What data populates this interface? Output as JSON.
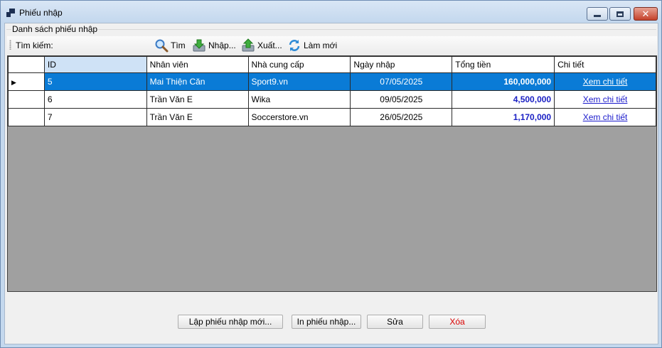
{
  "window": {
    "title": "Phiếu nhập"
  },
  "group": {
    "label": "Danh sách phiếu nhập"
  },
  "toolbar": {
    "search_label": "Tìm kiếm:",
    "find_label": "Tìm",
    "import_label": "Nhập...",
    "export_label": "Xuất...",
    "refresh_label": "Làm mới"
  },
  "grid": {
    "columns": [
      "ID",
      "Nhân viên",
      "Nhà cung cấp",
      "Ngày nhập",
      "Tổng tiền",
      "Chi tiết"
    ],
    "rows": [
      {
        "id": "5",
        "employee": "Mai Thiện Căn",
        "supplier": "Sport9.vn",
        "date": "07/05/2025",
        "total": "160,000,000",
        "detail": "Xem chi tiết",
        "selected": true
      },
      {
        "id": "6",
        "employee": "Trần Văn E",
        "supplier": "Wika",
        "date": "09/05/2025",
        "total": "4,500,000",
        "detail": "Xem chi tiết"
      },
      {
        "id": "7",
        "employee": "Trần Văn E",
        "supplier": "Soccerstore.vn",
        "date": "26/05/2025",
        "total": "1,170,000",
        "detail": "Xem chi tiết"
      }
    ]
  },
  "buttons": {
    "new_label": "Lập phiếu nhập mới...",
    "print_label": "In phiếu nhập...",
    "edit_label": "Sửa",
    "delete_label": "Xóa"
  },
  "colors": {
    "selection": "#0a7bd6",
    "money": "#1a20c4",
    "delete": "#d80000"
  }
}
